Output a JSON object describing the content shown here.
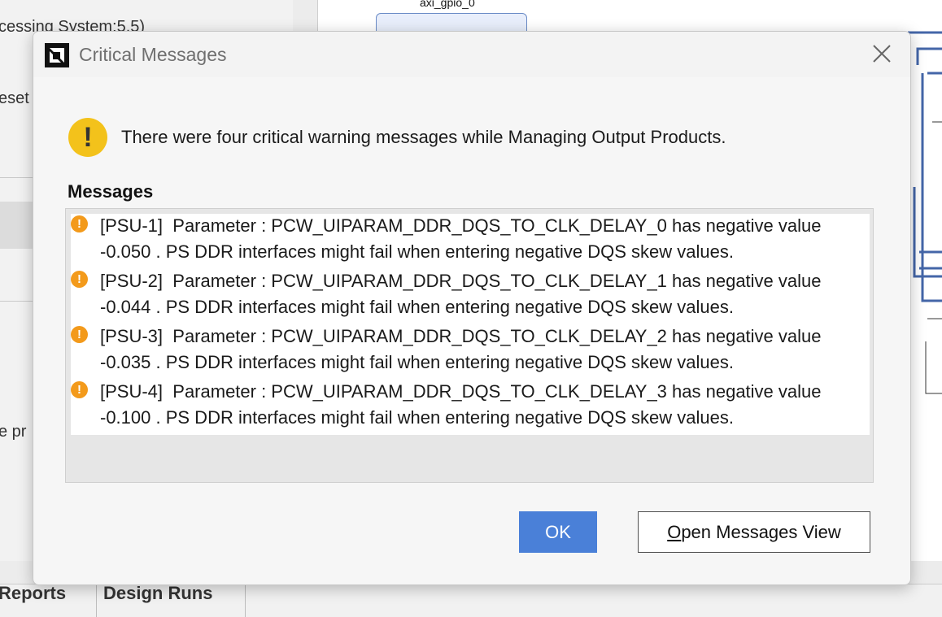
{
  "background": {
    "left_panel_texts": [
      "cessing System:5.5)",
      "eset",
      "e pr"
    ],
    "canvas_block_label": "axi_gpio_0",
    "bottom_tabs": [
      "Reports",
      "Design Runs"
    ]
  },
  "dialog": {
    "title": "Critical Messages",
    "app_icon": "amd-logo-icon",
    "close_icon": "close-icon",
    "summary": "There were four critical warning messages while Managing Output Products.",
    "section_label": "Messages",
    "messages": [
      {
        "id": "[PSU-1]",
        "line1": "Parameter : PCW_UIPARAM_DDR_DQS_TO_CLK_DELAY_0 has negative value",
        "line2": "-0.050 . PS DDR interfaces might fail when entering negative DQS skew values."
      },
      {
        "id": "[PSU-2]",
        "line1": "Parameter : PCW_UIPARAM_DDR_DQS_TO_CLK_DELAY_1 has negative value",
        "line2": "-0.044 . PS DDR interfaces might fail when entering negative DQS skew values."
      },
      {
        "id": "[PSU-3]",
        "line1": "Parameter : PCW_UIPARAM_DDR_DQS_TO_CLK_DELAY_2 has negative value",
        "line2": "-0.035 . PS DDR interfaces might fail when entering negative DQS skew values."
      },
      {
        "id": "[PSU-4]",
        "line1": "Parameter : PCW_UIPARAM_DDR_DQS_TO_CLK_DELAY_3 has negative value",
        "line2": "-0.100 . PS DDR interfaces might fail when entering negative DQS skew values."
      }
    ],
    "ok_label": "OK",
    "open_view_label_first": "O",
    "open_view_label_rest": "pen Messages View"
  },
  "colors": {
    "accent": "#4a80d8",
    "warning_yellow": "#f3c21b",
    "message_orange": "#f39a1b"
  }
}
